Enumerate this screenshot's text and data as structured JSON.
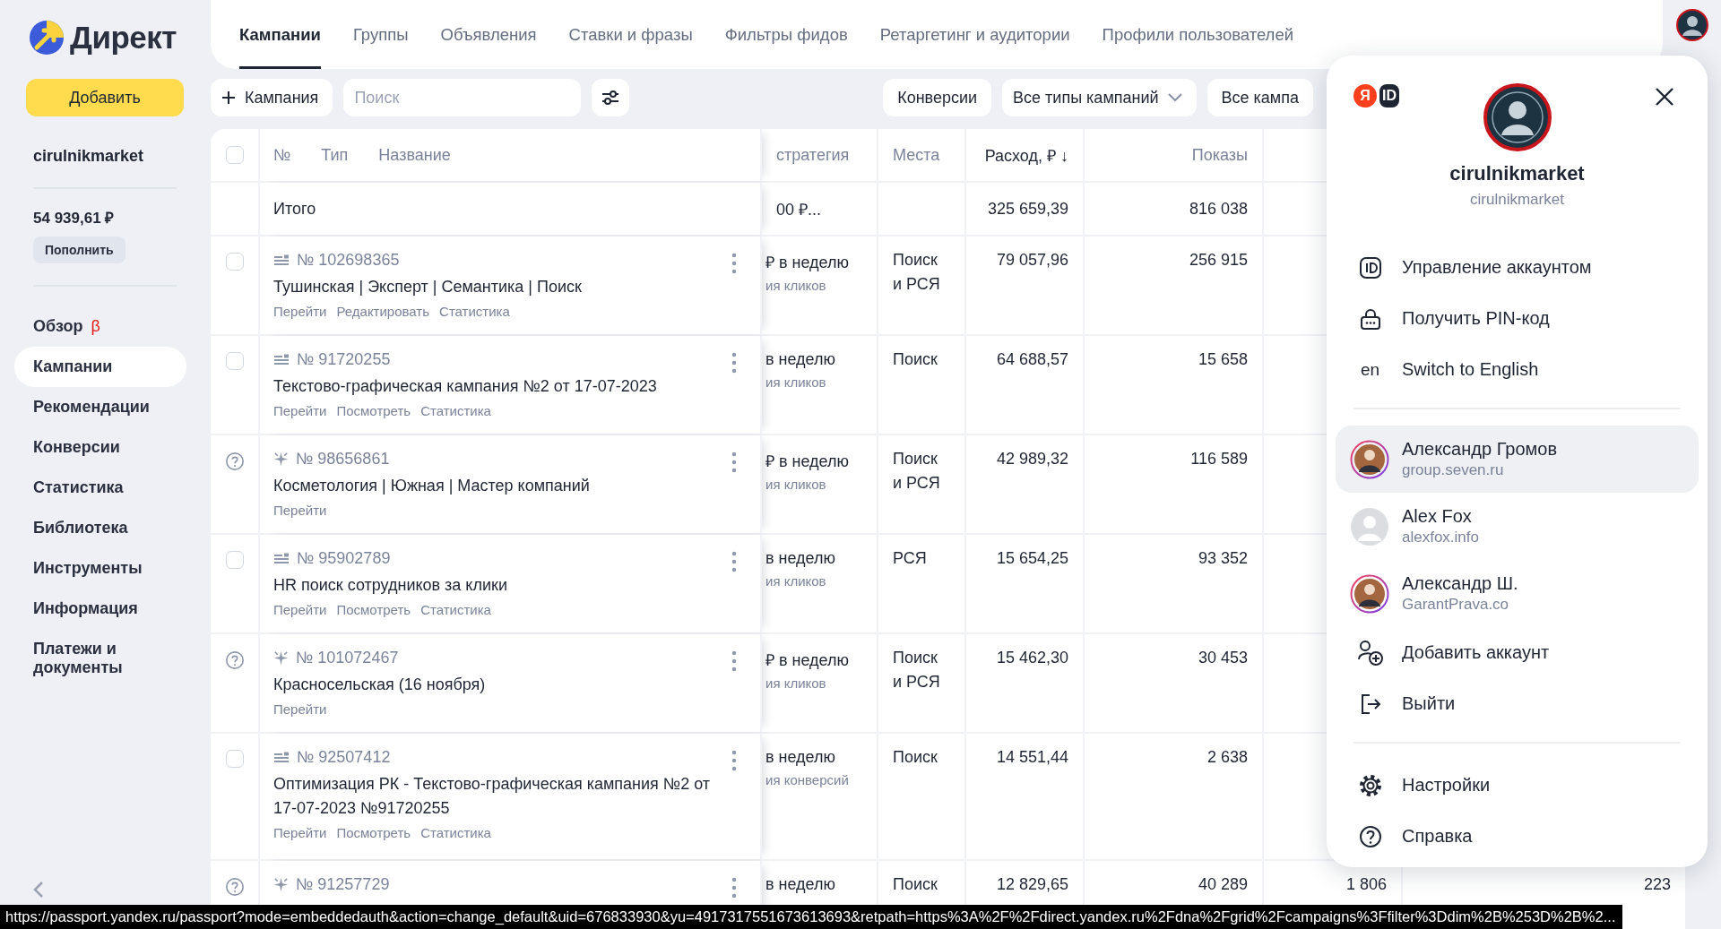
{
  "app": {
    "logo_text": "Директ"
  },
  "sidebar": {
    "add_button": "Добавить",
    "account": "cirulnikmarket",
    "balance": "54 939,61 ₽",
    "top_up_button": "Пополнить",
    "nav": [
      {
        "label": "Обзор",
        "badge": "β",
        "selected": false
      },
      {
        "label": "Кампании",
        "selected": true
      },
      {
        "label": "Рекомендации",
        "selected": false
      },
      {
        "label": "Конверсии",
        "selected": false
      },
      {
        "label": "Статистика",
        "selected": false
      },
      {
        "label": "Библиотека",
        "selected": false
      },
      {
        "label": "Инструменты",
        "selected": false
      },
      {
        "label": "Информация",
        "selected": false
      },
      {
        "label": "Платежи и документы",
        "selected": false
      }
    ]
  },
  "tabs": [
    {
      "label": "Кампании",
      "selected": true
    },
    {
      "label": "Группы",
      "selected": false
    },
    {
      "label": "Объявления",
      "selected": false
    },
    {
      "label": "Ставки и фразы",
      "selected": false
    },
    {
      "label": "Фильтры фидов",
      "selected": false
    },
    {
      "label": "Ретаргетинг и аудитории",
      "selected": false
    },
    {
      "label": "Профили пользователей",
      "selected": false
    }
  ],
  "toolbar": {
    "new_button": "Кампания",
    "search": {
      "placeholder": "Поиск"
    },
    "filters": [
      {
        "label": "Конверсии",
        "kind": "button"
      },
      {
        "label": "Все типы кампаний",
        "kind": "dropdown"
      },
      {
        "label": "Все кампа",
        "kind": "button"
      }
    ]
  },
  "table": {
    "header_checked": false,
    "name_headers": [
      "№",
      "Тип",
      "Название"
    ],
    "columns": [
      {
        "label": "стратегия",
        "kind": "text",
        "sorted": false
      },
      {
        "label": "Места",
        "kind": "text",
        "sorted": false
      },
      {
        "label": "Расход, ₽ ↓",
        "kind": "number",
        "sorted": true
      },
      {
        "label": "Показы",
        "kind": "number",
        "sorted": false
      }
    ],
    "total": {
      "label": "Итого",
      "strategy": "00 ₽...",
      "spend": "325 659,39",
      "impressions": "816 038"
    },
    "rows": [
      {
        "kind": "checkbox",
        "checked": false,
        "ad_type": {
          "kind": "text"
        },
        "number": "№ 102698365",
        "name": "Тушинская | Эксперт | Семантика | Поиск",
        "actions": [
          "Перейти",
          "Редактировать",
          "Статистика"
        ],
        "strategy": "₽ в неделю",
        "strategy_note": "ия кликов",
        "places": "Поиск и РСЯ",
        "spend": "79 057,96",
        "impressions": "256 915"
      },
      {
        "kind": "checkbox",
        "checked": false,
        "ad_type": {
          "kind": "text"
        },
        "number": "№ 91720255",
        "name": "Текстово-графическая кампания №2 от 17-07-2023",
        "actions": [
          "Перейти",
          "Посмотреть",
          "Статистика"
        ],
        "strategy": "в неделю",
        "strategy_note": "ия кликов",
        "places": "Поиск",
        "spend": "64 688,57",
        "impressions": "15 658"
      },
      {
        "kind": "help",
        "ad_type": {
          "kind": "master"
        },
        "number": "№ 98656861",
        "name": "Косметология | Южная | Мастер компаний",
        "actions": [
          "Перейти"
        ],
        "strategy": "₽ в неделю",
        "strategy_note": "ия кликов",
        "places": "Поиск и РСЯ",
        "spend": "42 989,32",
        "impressions": "116 589"
      },
      {
        "kind": "checkbox",
        "checked": false,
        "ad_type": {
          "kind": "text"
        },
        "number": "№ 95902789",
        "name": "HR поиск сотрудников за клики",
        "actions": [
          "Перейти",
          "Посмотреть",
          "Статистика"
        ],
        "strategy": "в неделю",
        "strategy_note": "ия кликов",
        "places": "РСЯ",
        "spend": "15 654,25",
        "impressions": "93 352"
      },
      {
        "kind": "help",
        "ad_type": {
          "kind": "master"
        },
        "number": "№ 101072467",
        "name": "Красносельская (16 ноября)",
        "actions": [
          "Перейти"
        ],
        "strategy": "₽ в неделю",
        "strategy_note": "ия кликов",
        "places": "Поиск и РСЯ",
        "spend": "15 462,30",
        "impressions": "30 453"
      },
      {
        "kind": "checkbox",
        "checked": false,
        "ad_type": {
          "kind": "text"
        },
        "number": "№ 92507412",
        "name": "Оптимизация РК - Текстово-графическая кампания №2 от 17-07-2023 №91720255",
        "actions": [
          "Перейти",
          "Посмотреть",
          "Статистика"
        ],
        "strategy": "в неделю",
        "strategy_note": "ия конверсий",
        "places": "Поиск",
        "spend": "14 551,44",
        "impressions": "2 638"
      },
      {
        "kind": "help",
        "ad_type": {
          "kind": "master"
        },
        "number": "№ 91257729",
        "strategy": "в неделю",
        "places": "Поиск",
        "spend": "12 829,65",
        "impressions": "40 289",
        "column_7": "1 806",
        "column_8": "223"
      }
    ]
  },
  "account_menu": {
    "brand": [
      "Я",
      "ID"
    ],
    "user": {
      "name": "cirulnikmarket",
      "login": "cirulnikmarket"
    },
    "items": [
      {
        "kind": "manage",
        "label": "Управление аккаунтом"
      },
      {
        "kind": "pin",
        "label": "Получить PIN-код"
      },
      {
        "kind": "language",
        "icon_text": "en",
        "label": "Switch to English"
      }
    ],
    "accounts": [
      {
        "name": "Александр Громов",
        "domain": "group.seven.ru",
        "selected": true,
        "avatar": {
          "kind": "photo"
        }
      },
      {
        "name": "Alex Fox",
        "domain": "alexfox.info",
        "selected": false,
        "avatar": {
          "kind": "placeholder"
        }
      },
      {
        "name": "Александр Ш.",
        "domain": "GarantPrava.co",
        "selected": false,
        "avatar": {
          "kind": "photo"
        }
      }
    ],
    "actions": [
      {
        "kind": "add",
        "label": "Добавить аккаунт"
      },
      {
        "kind": "logout",
        "label": "Выйти"
      }
    ],
    "footer": [
      {
        "kind": "settings",
        "label": "Настройки"
      },
      {
        "kind": "help",
        "label": "Справка"
      }
    ]
  },
  "status_bar": {
    "url": "https://passport.yandex.ru/passport?mode=embeddedauth&action=change_default&uid=676833930&yu=4917317551673613693&retpath=https%3A%2F%2Fdirect.yandex.ru%2Fdna%2Fgrid%2Fcampaigns%3Ffilter%3Ddim%2B%253D%2B%2..."
  }
}
